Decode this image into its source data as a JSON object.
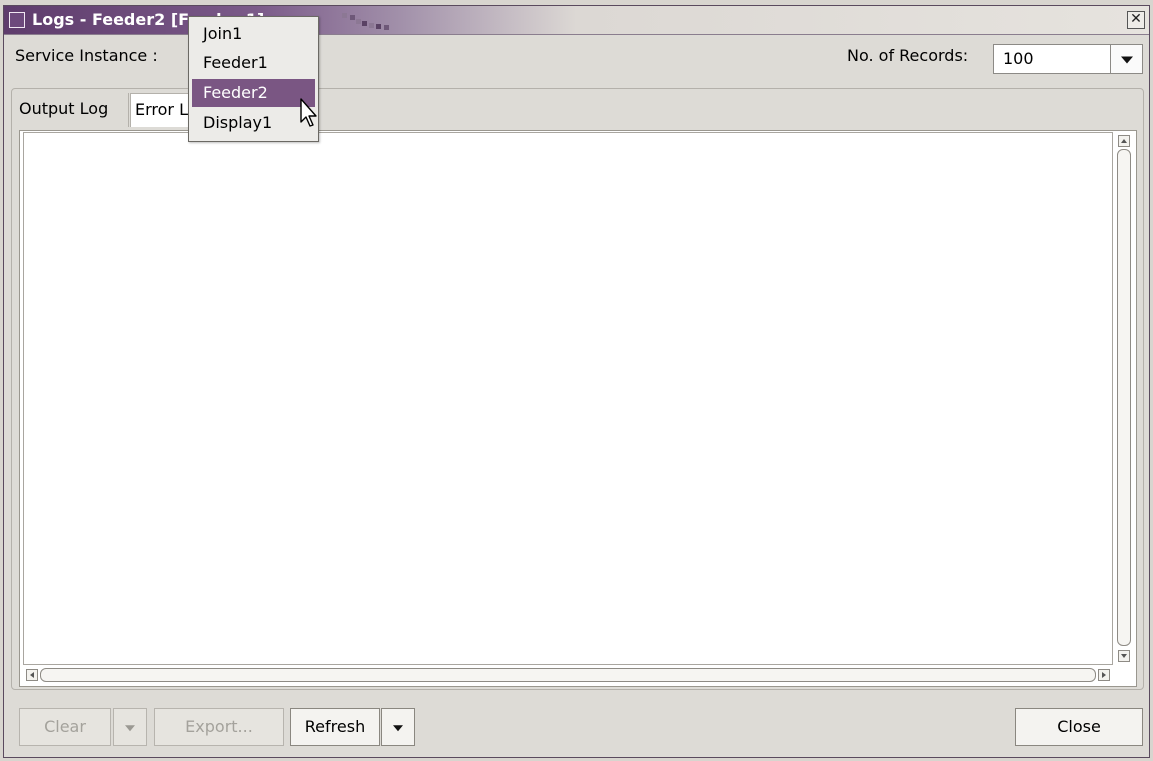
{
  "window": {
    "title": "Logs - Feeder2 [Feeder 1]",
    "accent_color": "#7a5683",
    "close_icon": "close-icon"
  },
  "toolbar": {
    "service_instance_label": "Service Instance :",
    "records_label": "No. of Records:",
    "records_value": "100"
  },
  "tabs": [
    {
      "label": "Output Log"
    },
    {
      "label": "Error Log"
    }
  ],
  "buttons": {
    "clear_label": "Clear",
    "export_label": "Export...",
    "refresh_label": "Refresh",
    "close_label": "Close"
  },
  "service_dropdown": {
    "options": [
      "Join1",
      "Feeder1",
      "Feeder2",
      "Display1"
    ],
    "highlighted": "Feeder2"
  }
}
